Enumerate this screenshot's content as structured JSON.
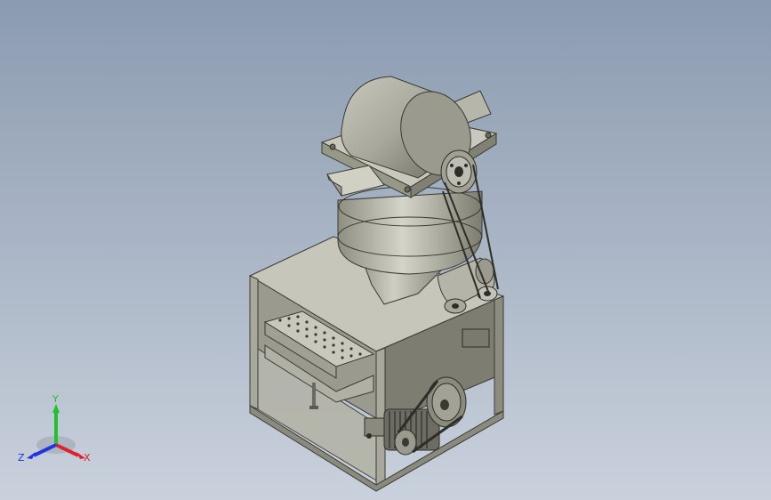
{
  "view": {
    "background_top": "#8b9bb0",
    "background_bottom": "#c9d1dc",
    "model_color": "#b8b8ac"
  },
  "triad": {
    "x_label": "X",
    "y_label": "Y",
    "z_label": "Z",
    "x_color": "#e0202a",
    "y_color": "#22c02a",
    "z_color": "#2233e0"
  }
}
